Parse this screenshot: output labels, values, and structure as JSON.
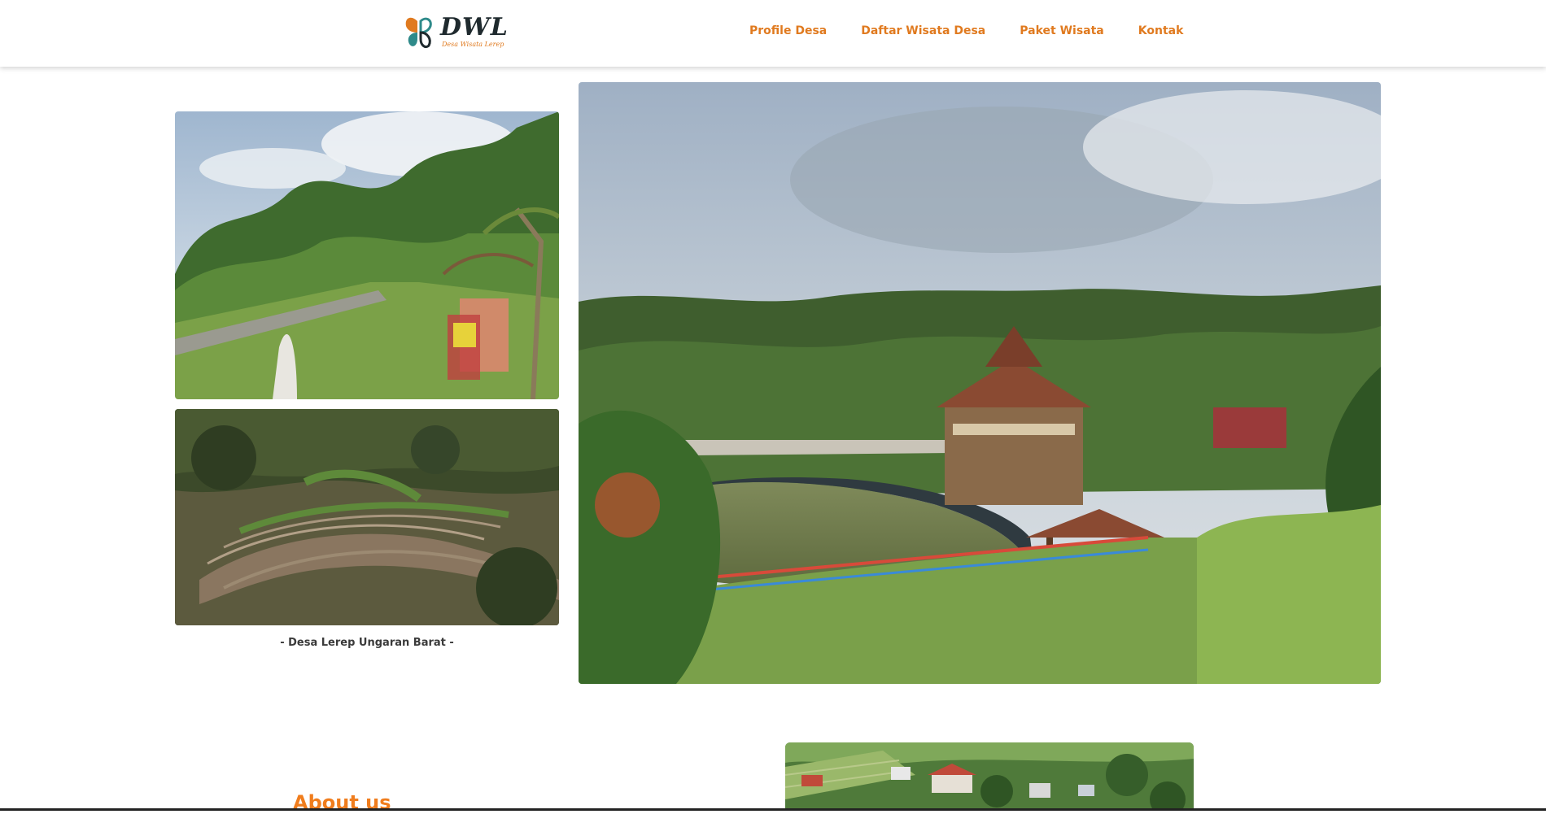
{
  "brand": {
    "name": "DWL",
    "tagline": "Desa Wisata Lerep"
  },
  "nav": {
    "items": [
      {
        "label": "Profile Desa"
      },
      {
        "label": "Daftar Wisata Desa"
      },
      {
        "label": "Paket Wisata"
      },
      {
        "label": "Kontak"
      }
    ]
  },
  "hero": {
    "caption": "- Desa Lerep Ungaran Barat -"
  },
  "about": {
    "title": "About us"
  },
  "colors": {
    "accent": "#e07a1f",
    "about_title": "#f07d1d",
    "text": "#3a3a3a"
  }
}
